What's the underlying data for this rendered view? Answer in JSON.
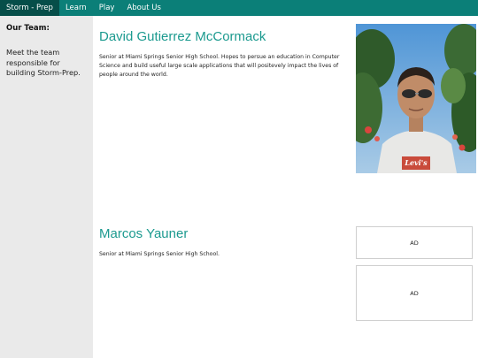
{
  "nav": {
    "items": [
      {
        "label": "Storm - Prep",
        "active": true
      },
      {
        "label": "Learn",
        "active": false
      },
      {
        "label": "Play",
        "active": false
      },
      {
        "label": "About Us",
        "active": false
      }
    ]
  },
  "sidebar": {
    "heading": "Our Team:",
    "text": "Meet the team responsible for building Storm-Prep."
  },
  "members": [
    {
      "name": "David Gutierrez McCormack",
      "bio": "Senior at Miami Springs Senior High School. Hopes to persue an education in Computer Science and build useful large scale applications that will positevely impact the lives of people around the world.",
      "shirt_text": "Levi's"
    },
    {
      "name": "Marcos Yauner",
      "bio": "Senior at Miami Springs Senior High School."
    }
  ],
  "ads": [
    {
      "label": "AD"
    },
    {
      "label": "AD"
    }
  ],
  "colors": {
    "nav_bg": "#0b7f78",
    "nav_active": "#064e49",
    "name_accent": "#1c9a8f",
    "sidebar_bg": "#eaeaea"
  }
}
